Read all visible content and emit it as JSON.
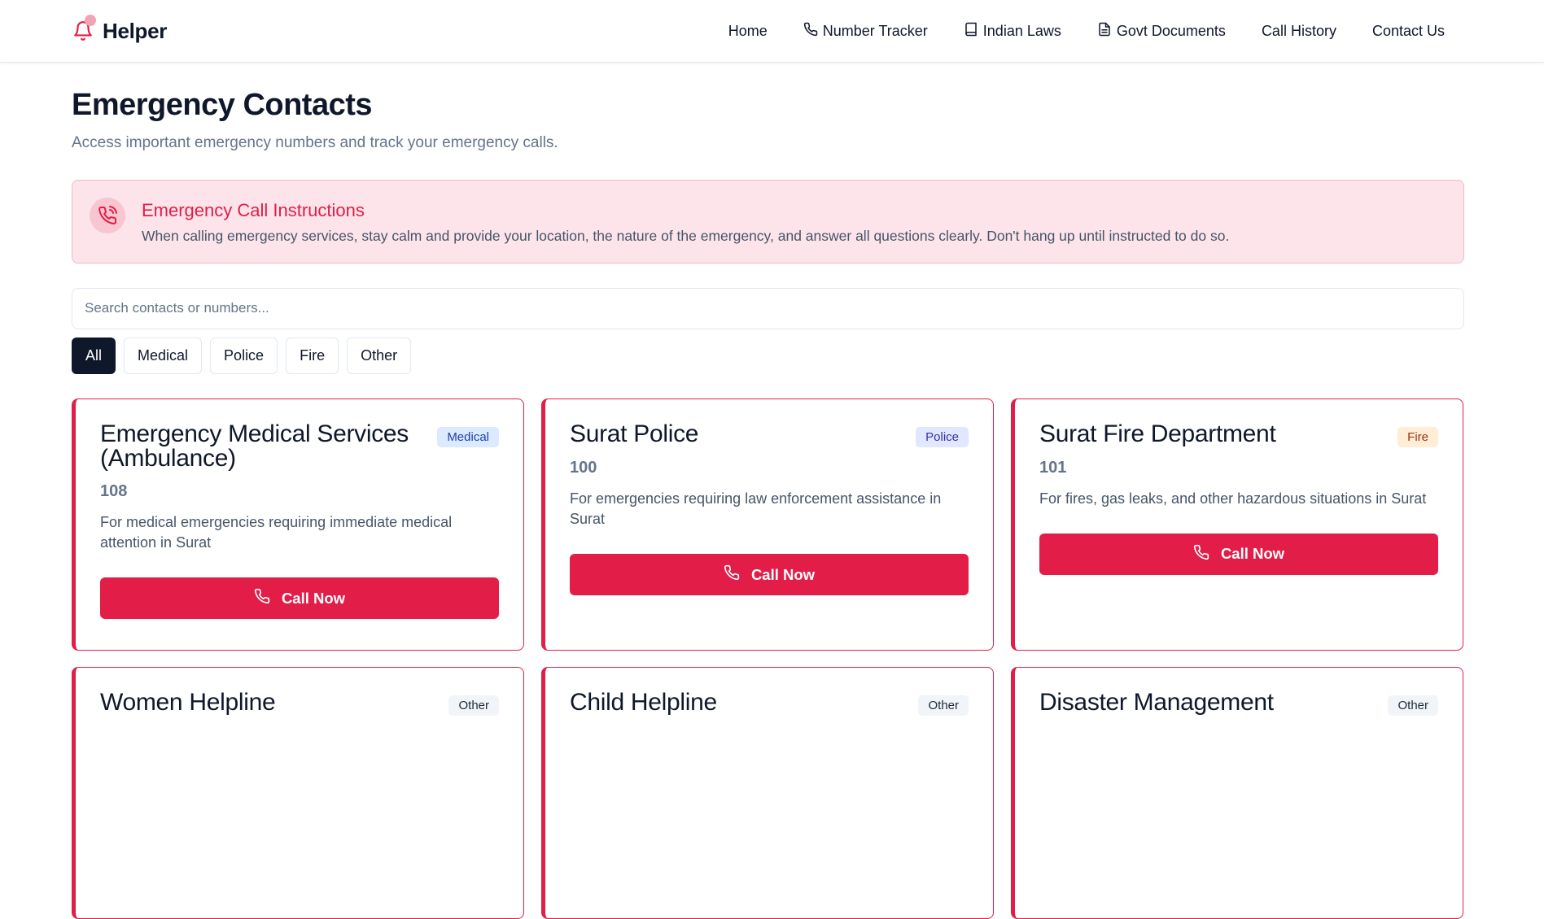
{
  "app": {
    "logo_text": "Helper"
  },
  "nav": {
    "items": [
      {
        "label": "Home",
        "icon": ""
      },
      {
        "label": "Number Tracker",
        "icon": "phone-icon"
      },
      {
        "label": "Indian Laws",
        "icon": "book-icon"
      },
      {
        "label": "Govt Documents",
        "icon": "document-icon"
      },
      {
        "label": "Call History",
        "icon": ""
      },
      {
        "label": "Contact Us",
        "icon": ""
      }
    ]
  },
  "page": {
    "title": "Emergency Contacts",
    "subtitle": "Access important emergency numbers and track your emergency calls."
  },
  "alert": {
    "title": "Emergency Call Instructions",
    "text": "When calling emergency services, stay calm and provide your location, the nature of the emergency, and answer all questions clearly. Don't hang up until instructed to do so.",
    "icon": "phone-call-icon"
  },
  "search": {
    "placeholder": "Search contacts or numbers...",
    "value": ""
  },
  "filters": {
    "active": "All",
    "items": [
      "All",
      "Medical",
      "Police",
      "Fire",
      "Other"
    ]
  },
  "cards": [
    {
      "title": "Emergency Medical Services (Ambulance)",
      "category": "Medical",
      "number": "108",
      "description": "For medical emergencies requiring immediate medical attention in Surat",
      "button_label": "Call Now"
    },
    {
      "title": "Surat Police",
      "category": "Police",
      "number": "100",
      "description": "For emergencies requiring law enforcement assistance in Surat",
      "button_label": "Call Now"
    },
    {
      "title": "Surat Fire Department",
      "category": "Fire",
      "number": "101",
      "description": "For fires, gas leaks, and other hazardous situations in Surat",
      "button_label": "Call Now"
    },
    {
      "title": "Women Helpline",
      "category": "Other"
    },
    {
      "title": "Child Helpline",
      "category": "Other"
    },
    {
      "title": "Disaster Management",
      "category": "Other"
    }
  ],
  "colors": {
    "accent": "#e11d48",
    "dark": "#0f172a",
    "alert_bg": "#fce4ea"
  }
}
